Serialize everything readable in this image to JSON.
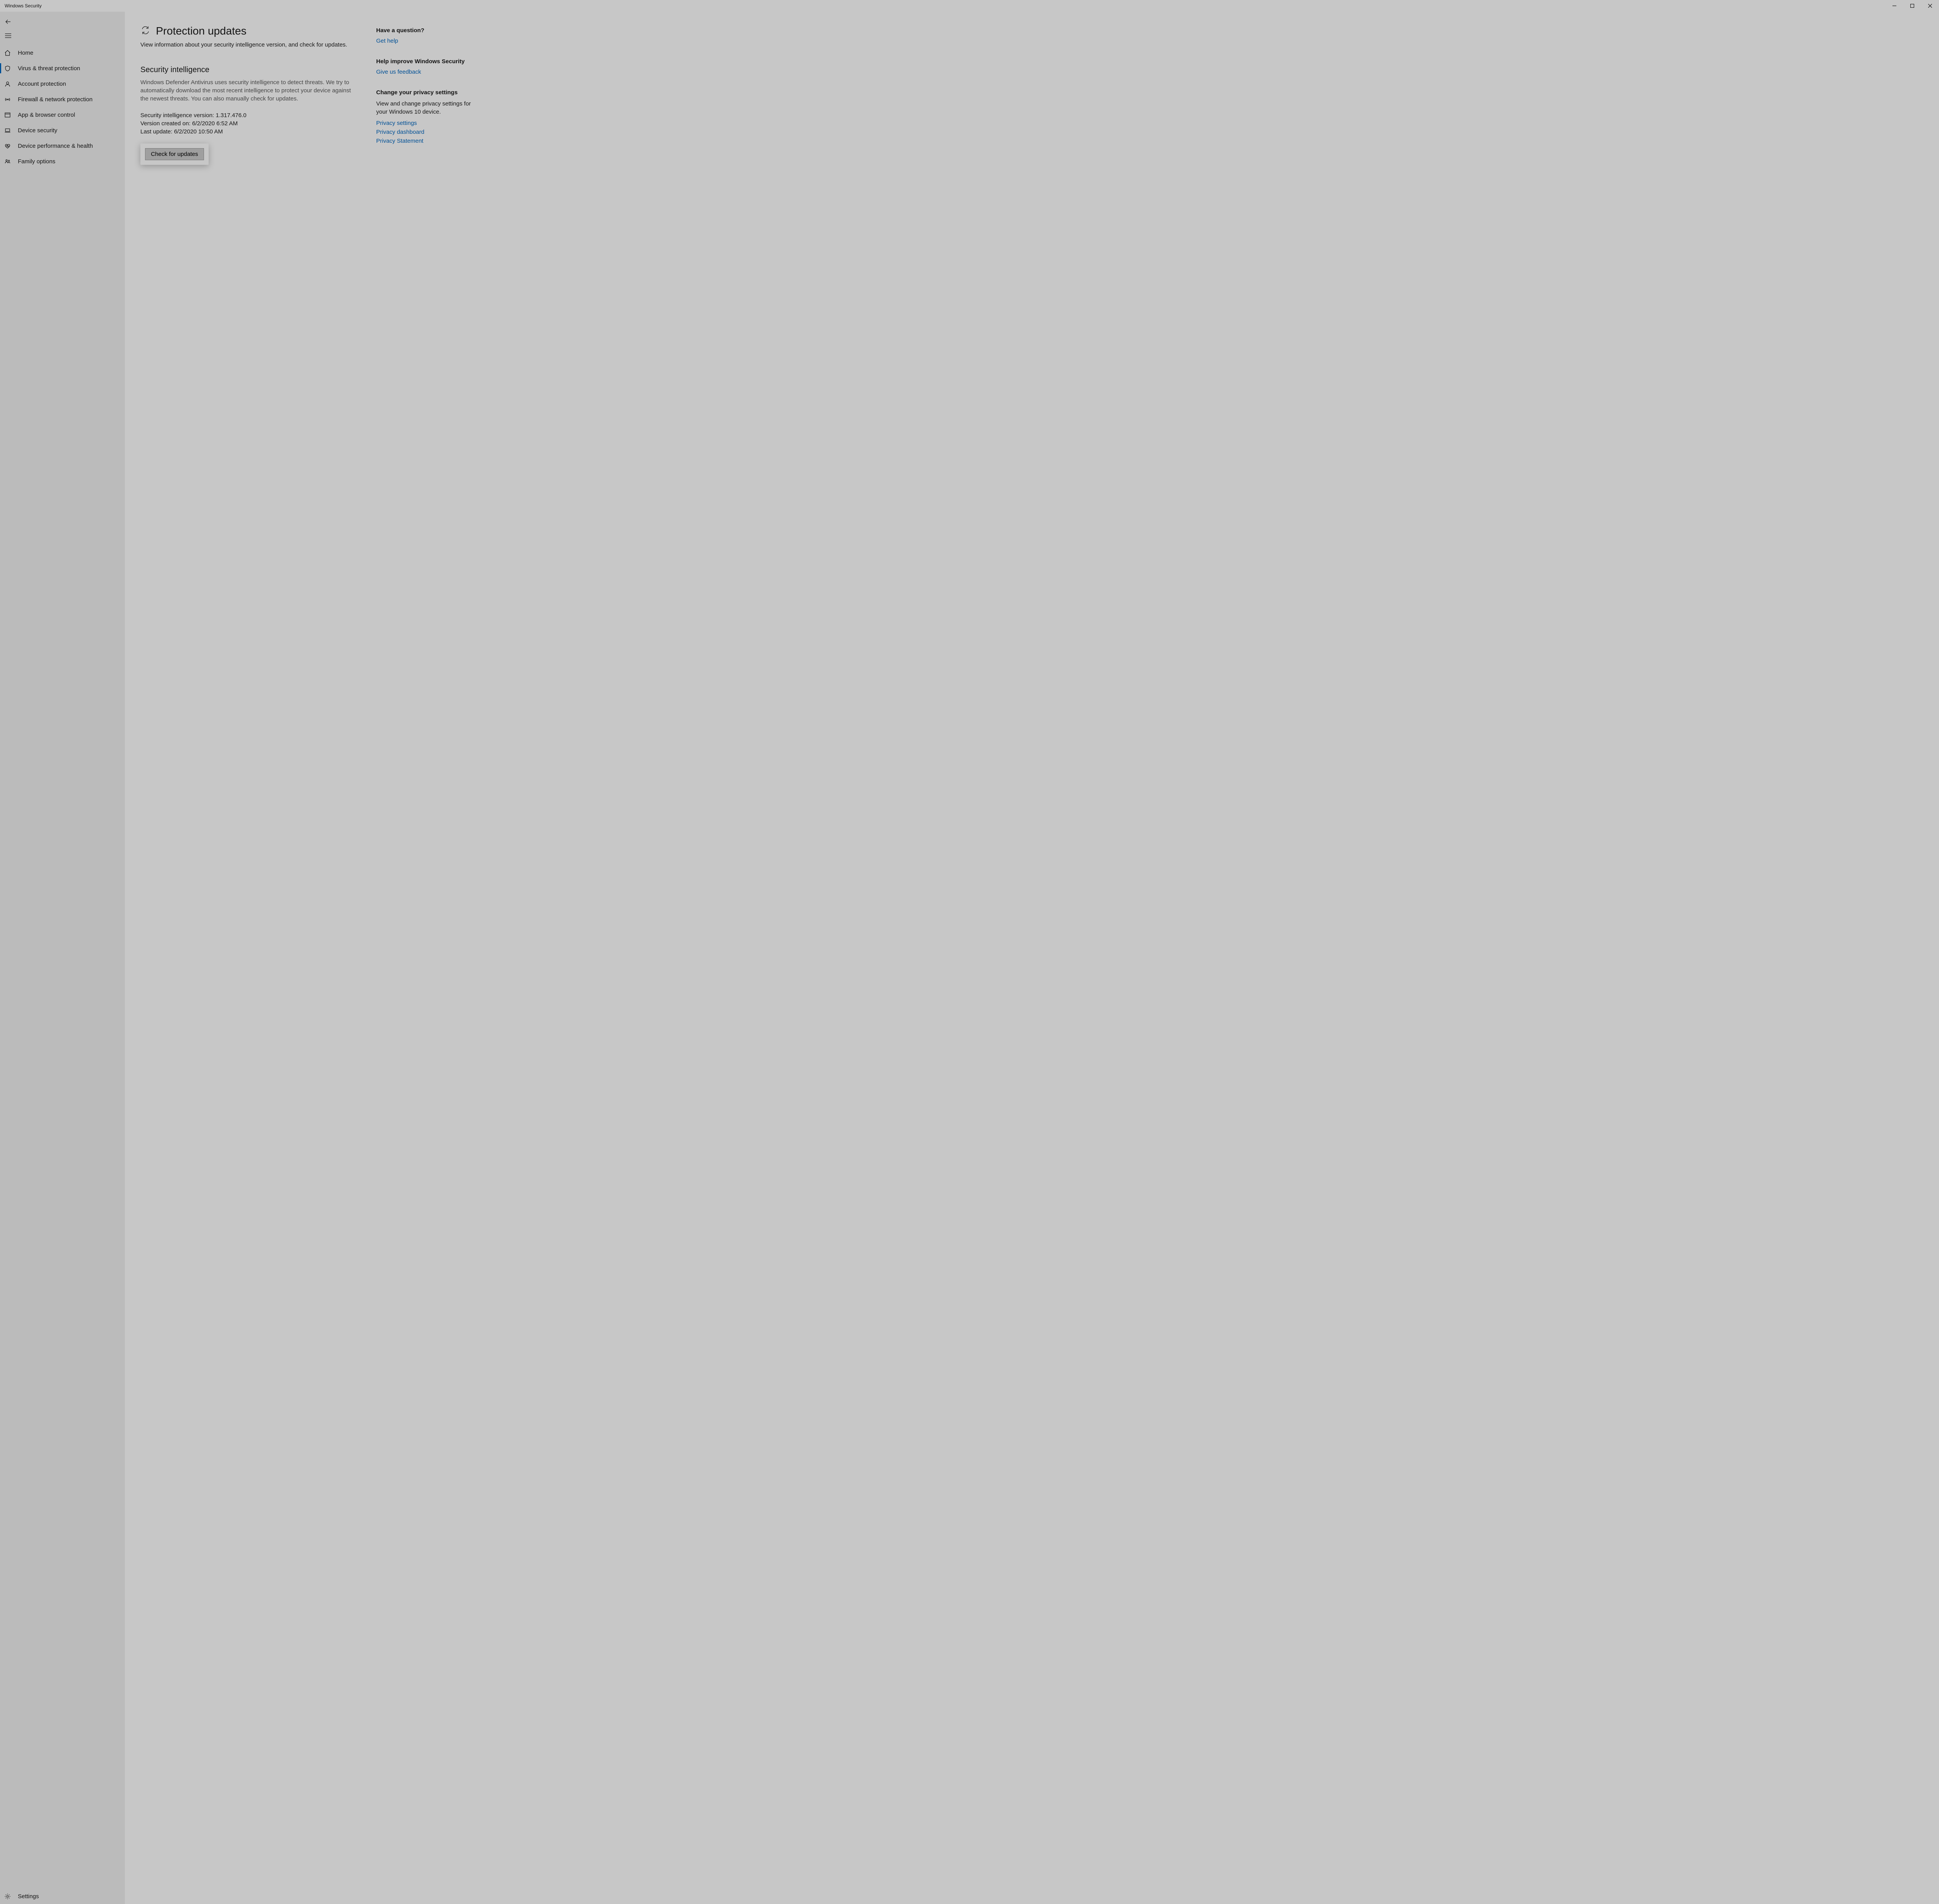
{
  "window": {
    "title": "Windows Security"
  },
  "sidebar": {
    "items": [
      {
        "label": "Home"
      },
      {
        "label": "Virus & threat protection"
      },
      {
        "label": "Account protection"
      },
      {
        "label": "Firewall & network protection"
      },
      {
        "label": "App & browser control"
      },
      {
        "label": "Device security"
      },
      {
        "label": "Device performance & health"
      },
      {
        "label": "Family options"
      }
    ],
    "settings_label": "Settings"
  },
  "page": {
    "title": "Protection updates",
    "description": "View information about your security intelligence version, and check for updates."
  },
  "security_intelligence": {
    "heading": "Security intelligence",
    "description": "Windows Defender Antivirus uses security intelligence to detect threats. We try to automatically download the most recent intelligence to protect your device against the newest threats. You can also manually check for updates.",
    "version_line": "Security intelligence version: 1.317.476.0",
    "created_line": "Version created on: 6/2/2020 6:52 AM",
    "updated_line": "Last update: 6/2/2020 10:50 AM",
    "button_label": "Check for updates"
  },
  "aside": {
    "question": {
      "heading": "Have a question?",
      "link": "Get help"
    },
    "improve": {
      "heading": "Help improve Windows Security",
      "link": "Give us feedback"
    },
    "privacy": {
      "heading": "Change your privacy settings",
      "text": "View and change privacy settings for your Windows 10 device.",
      "links": [
        "Privacy settings",
        "Privacy dashboard",
        "Privacy Statement"
      ]
    }
  }
}
